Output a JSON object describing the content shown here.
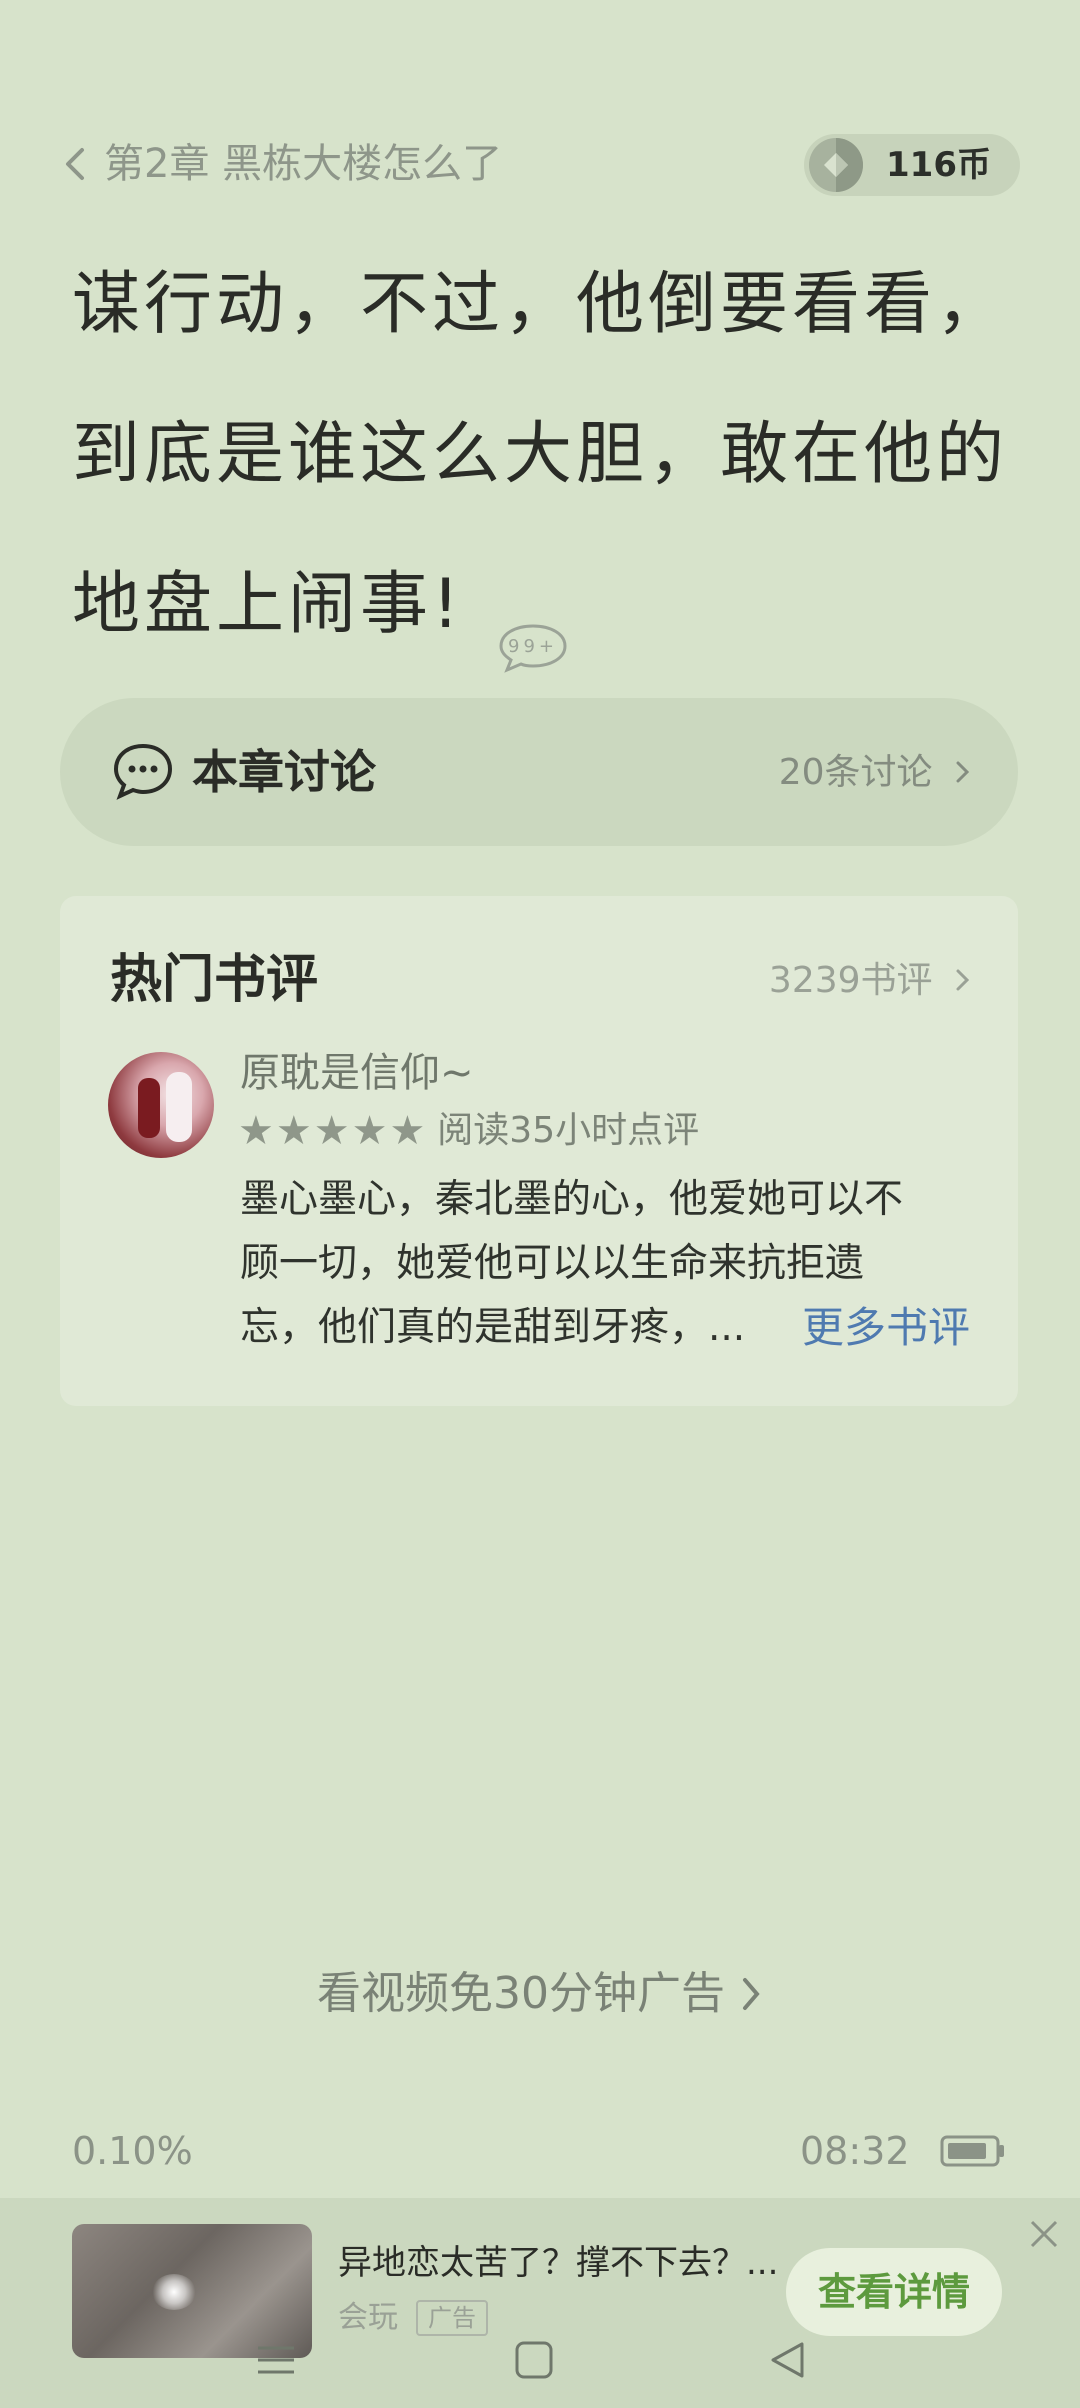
{
  "header": {
    "chapter_title": "第2章 黑栋大楼怎么了",
    "coins": "116币"
  },
  "content": {
    "lines": [
      "谋行动，不过，他倒要看看，",
      "到底是谁这么大胆，敢在他的",
      "地盘上闹事!"
    ],
    "comment_badge": "99+"
  },
  "discussion": {
    "label": "本章讨论",
    "count": "20条讨论"
  },
  "reviews": {
    "title": "热门书评",
    "count": "3239书评",
    "items": [
      {
        "user": "原耽是信仰~",
        "rating": 5,
        "meta": "阅读35小时点评",
        "text_lines": [
          "墨心墨心，秦北墨的心，他爱她可以不",
          "顾一切，她爱他可以以生命来抗拒遗",
          "忘，他们真的是甜到牙疼，..."
        ]
      }
    ],
    "more_label": "更多书评"
  },
  "video_cta": "看视频免30分钟广告",
  "status": {
    "progress": "0.10%",
    "time": "08:32"
  },
  "ad": {
    "title": "异地恋太苦了？撑不下去？...",
    "source": "会玩",
    "tag": "广告",
    "button": "查看详情"
  },
  "colors": {
    "background": "#d7e3cb",
    "accent_link": "#4f7ab0",
    "ad_button_text": "#5d9a3e"
  }
}
